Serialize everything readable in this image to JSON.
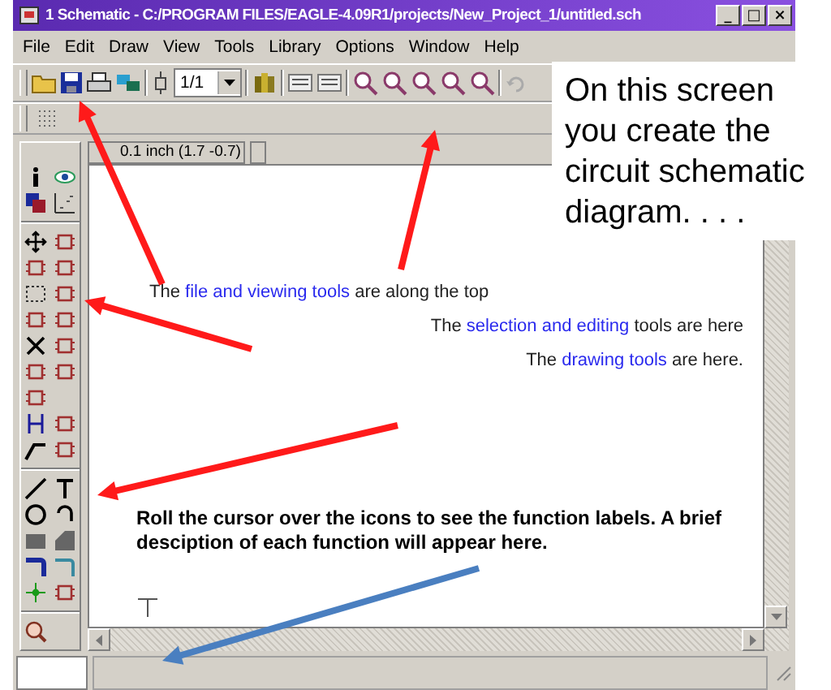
{
  "window": {
    "title": "1 Schematic - C:/PROGRAM FILES/EAGLE-4.09R1/projects/New_Project_1/untitled.sch",
    "controls": [
      "_",
      "□",
      "×"
    ]
  },
  "menu": [
    "File",
    "Edit",
    "Draw",
    "View",
    "Tools",
    "Library",
    "Options",
    "Window",
    "Help"
  ],
  "toolbar": {
    "sheet_select": "1/1"
  },
  "coordinates": "0.1 inch (1.7 -0.7)",
  "callout": "On this screen you create the circuit schematic diagram. . . .",
  "notes": [
    {
      "kind": "top",
      "parts": [
        {
          "text": "The ",
          "highlight": false
        },
        {
          "text": "file and viewing tools",
          "highlight": true
        },
        {
          "text": " are along the top",
          "highlight": false
        }
      ]
    },
    {
      "kind": "side",
      "parts": [
        {
          "text": "The ",
          "highlight": false
        },
        {
          "text": "selection and editing",
          "highlight": true
        },
        {
          "text": " tools are here",
          "highlight": false
        }
      ]
    },
    {
      "kind": "side",
      "parts": [
        {
          "text": "The ",
          "highlight": false
        },
        {
          "text": "drawing tools",
          "highlight": true
        },
        {
          "text": " are here.",
          "highlight": false
        }
      ]
    }
  ],
  "hint": "Roll the cursor over the icons to see the function labels. A brief desciption of each function will appear here.",
  "arrows": [
    {
      "color": "#ff1a1a"
    },
    {
      "color": "#ff1a1a"
    },
    {
      "color": "#ff1a1a"
    },
    {
      "color": "#ff1a1a"
    },
    {
      "color": "#4a7fc0"
    }
  ]
}
